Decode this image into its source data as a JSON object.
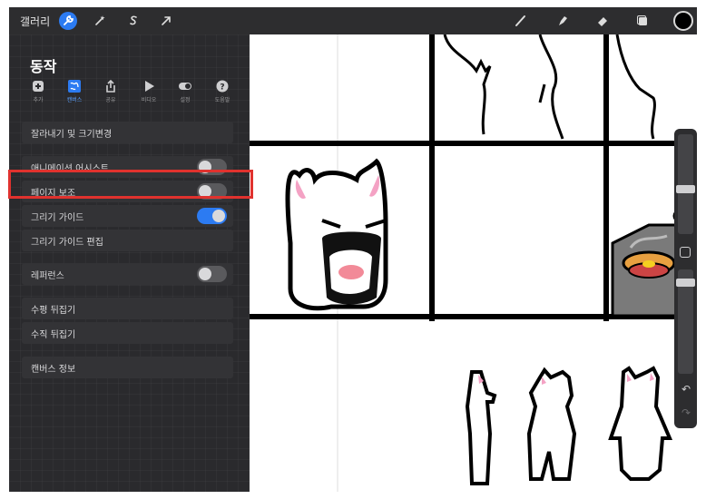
{
  "topbar": {
    "gallery_label": "갤러리",
    "left_tools": [
      "wrench-icon",
      "magic-wand-icon",
      "selection-icon",
      "transform-icon"
    ],
    "right_tools": [
      "brush-icon",
      "smudge-icon",
      "eraser-icon",
      "layers-icon"
    ],
    "current_color": "#000000"
  },
  "panel": {
    "title": "동작",
    "tabs": [
      {
        "label": "추가",
        "icon": "add-icon"
      },
      {
        "label": "캔버스",
        "icon": "canvas-icon",
        "active": true
      },
      {
        "label": "공유",
        "icon": "share-icon"
      },
      {
        "label": "비디오",
        "icon": "video-icon"
      },
      {
        "label": "설정",
        "icon": "settings-toggle-icon"
      },
      {
        "label": "도움말",
        "icon": "help-icon"
      }
    ],
    "items": {
      "crop_resize": "잘라내기 및 크기변경",
      "animation_assist": "애니메이션 어시스트",
      "page_assist": "페이지 보조",
      "drawing_guide": "그리기 가이드",
      "edit_drawing_guide": "그리기 가이드 편집",
      "reference": "레퍼런스",
      "flip_horizontal": "수평 뒤집기",
      "flip_vertical": "수직 뒤집기",
      "canvas_info": "캔버스 정보"
    },
    "toggles": {
      "animation_assist": false,
      "page_assist": false,
      "drawing_guide": true,
      "reference": false
    }
  },
  "colors": {
    "accent": "#2c7bf2",
    "highlight": "#e0322e"
  }
}
